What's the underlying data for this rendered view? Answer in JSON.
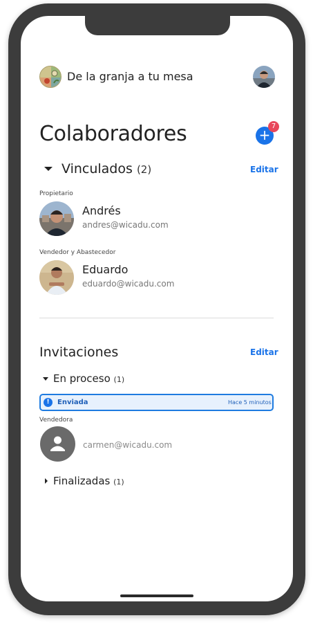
{
  "header": {
    "brand_name": "De la granja a tu mesa",
    "logo_icon": "farm-logo-icon",
    "avatar_icon": "user-avatar"
  },
  "page": {
    "title": "Colaboradores",
    "add_button_symbol": "+",
    "notification_count": "7"
  },
  "linked": {
    "title": "Vinculados",
    "count": "(2)",
    "edit_label": "Editar",
    "members": [
      {
        "role": "Propietario",
        "name": "Andrés",
        "email": "andres@wicadu.com"
      },
      {
        "role": "Vendedor y Abastecedor",
        "name": "Eduardo",
        "email": "eduardo@wicadu.com"
      }
    ]
  },
  "invitations": {
    "title": "Invitaciones",
    "edit_label": "Editar",
    "in_process": {
      "title": "En proceso",
      "count": "(1)",
      "status_symbol": "!",
      "status": "Enviada",
      "status_time": "Hace 5 minutos",
      "role": "Vendedora",
      "email": "carmen@wicadu.com"
    },
    "finished": {
      "title": "Finalizadas",
      "count": "(1)"
    }
  },
  "colors": {
    "accent": "#1a73e8",
    "badge": "#e8475b",
    "frame": "#3c3c3c"
  }
}
